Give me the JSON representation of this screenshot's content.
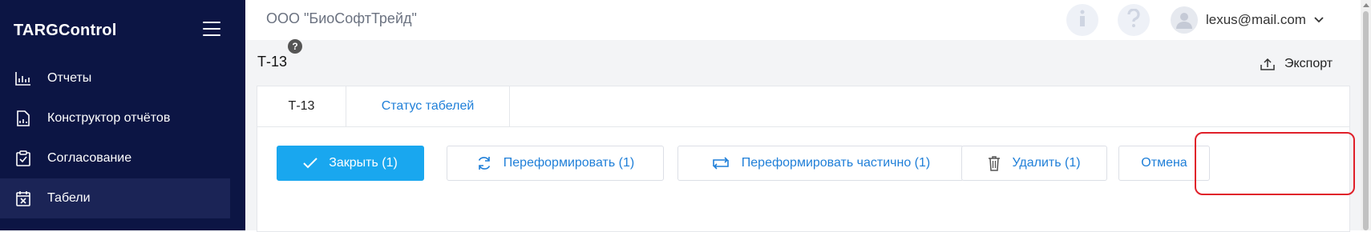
{
  "sidebar": {
    "logo": "TARGControl",
    "items": [
      {
        "label": "Отчеты",
        "icon": "chart-icon"
      },
      {
        "label": "Конструктор отчётов",
        "icon": "report-file-icon"
      },
      {
        "label": "Согласование",
        "icon": "clipboard-check-icon"
      },
      {
        "label": "Табели",
        "icon": "calendar-x-icon",
        "active": true
      }
    ]
  },
  "header": {
    "company": "ООО \"БиоСофтТрейд\"",
    "user_email": "lexus@mail.com"
  },
  "page": {
    "title": "Т-13",
    "help": "?",
    "export_label": "Экспорт"
  },
  "tabs": [
    {
      "label": "Т-13",
      "active": true
    },
    {
      "label": "Статус табелей"
    }
  ],
  "actions": {
    "close": "Закрыть (1)",
    "reform": "Переформировать (1)",
    "reform_partial": "Переформировать частично (1)",
    "delete": "Удалить (1)",
    "cancel": "Отмена"
  },
  "colors": {
    "sidebar_bg": "#0c1544",
    "primary": "#19a7ef",
    "link": "#1f7fd8",
    "highlight": "#e0202a"
  }
}
